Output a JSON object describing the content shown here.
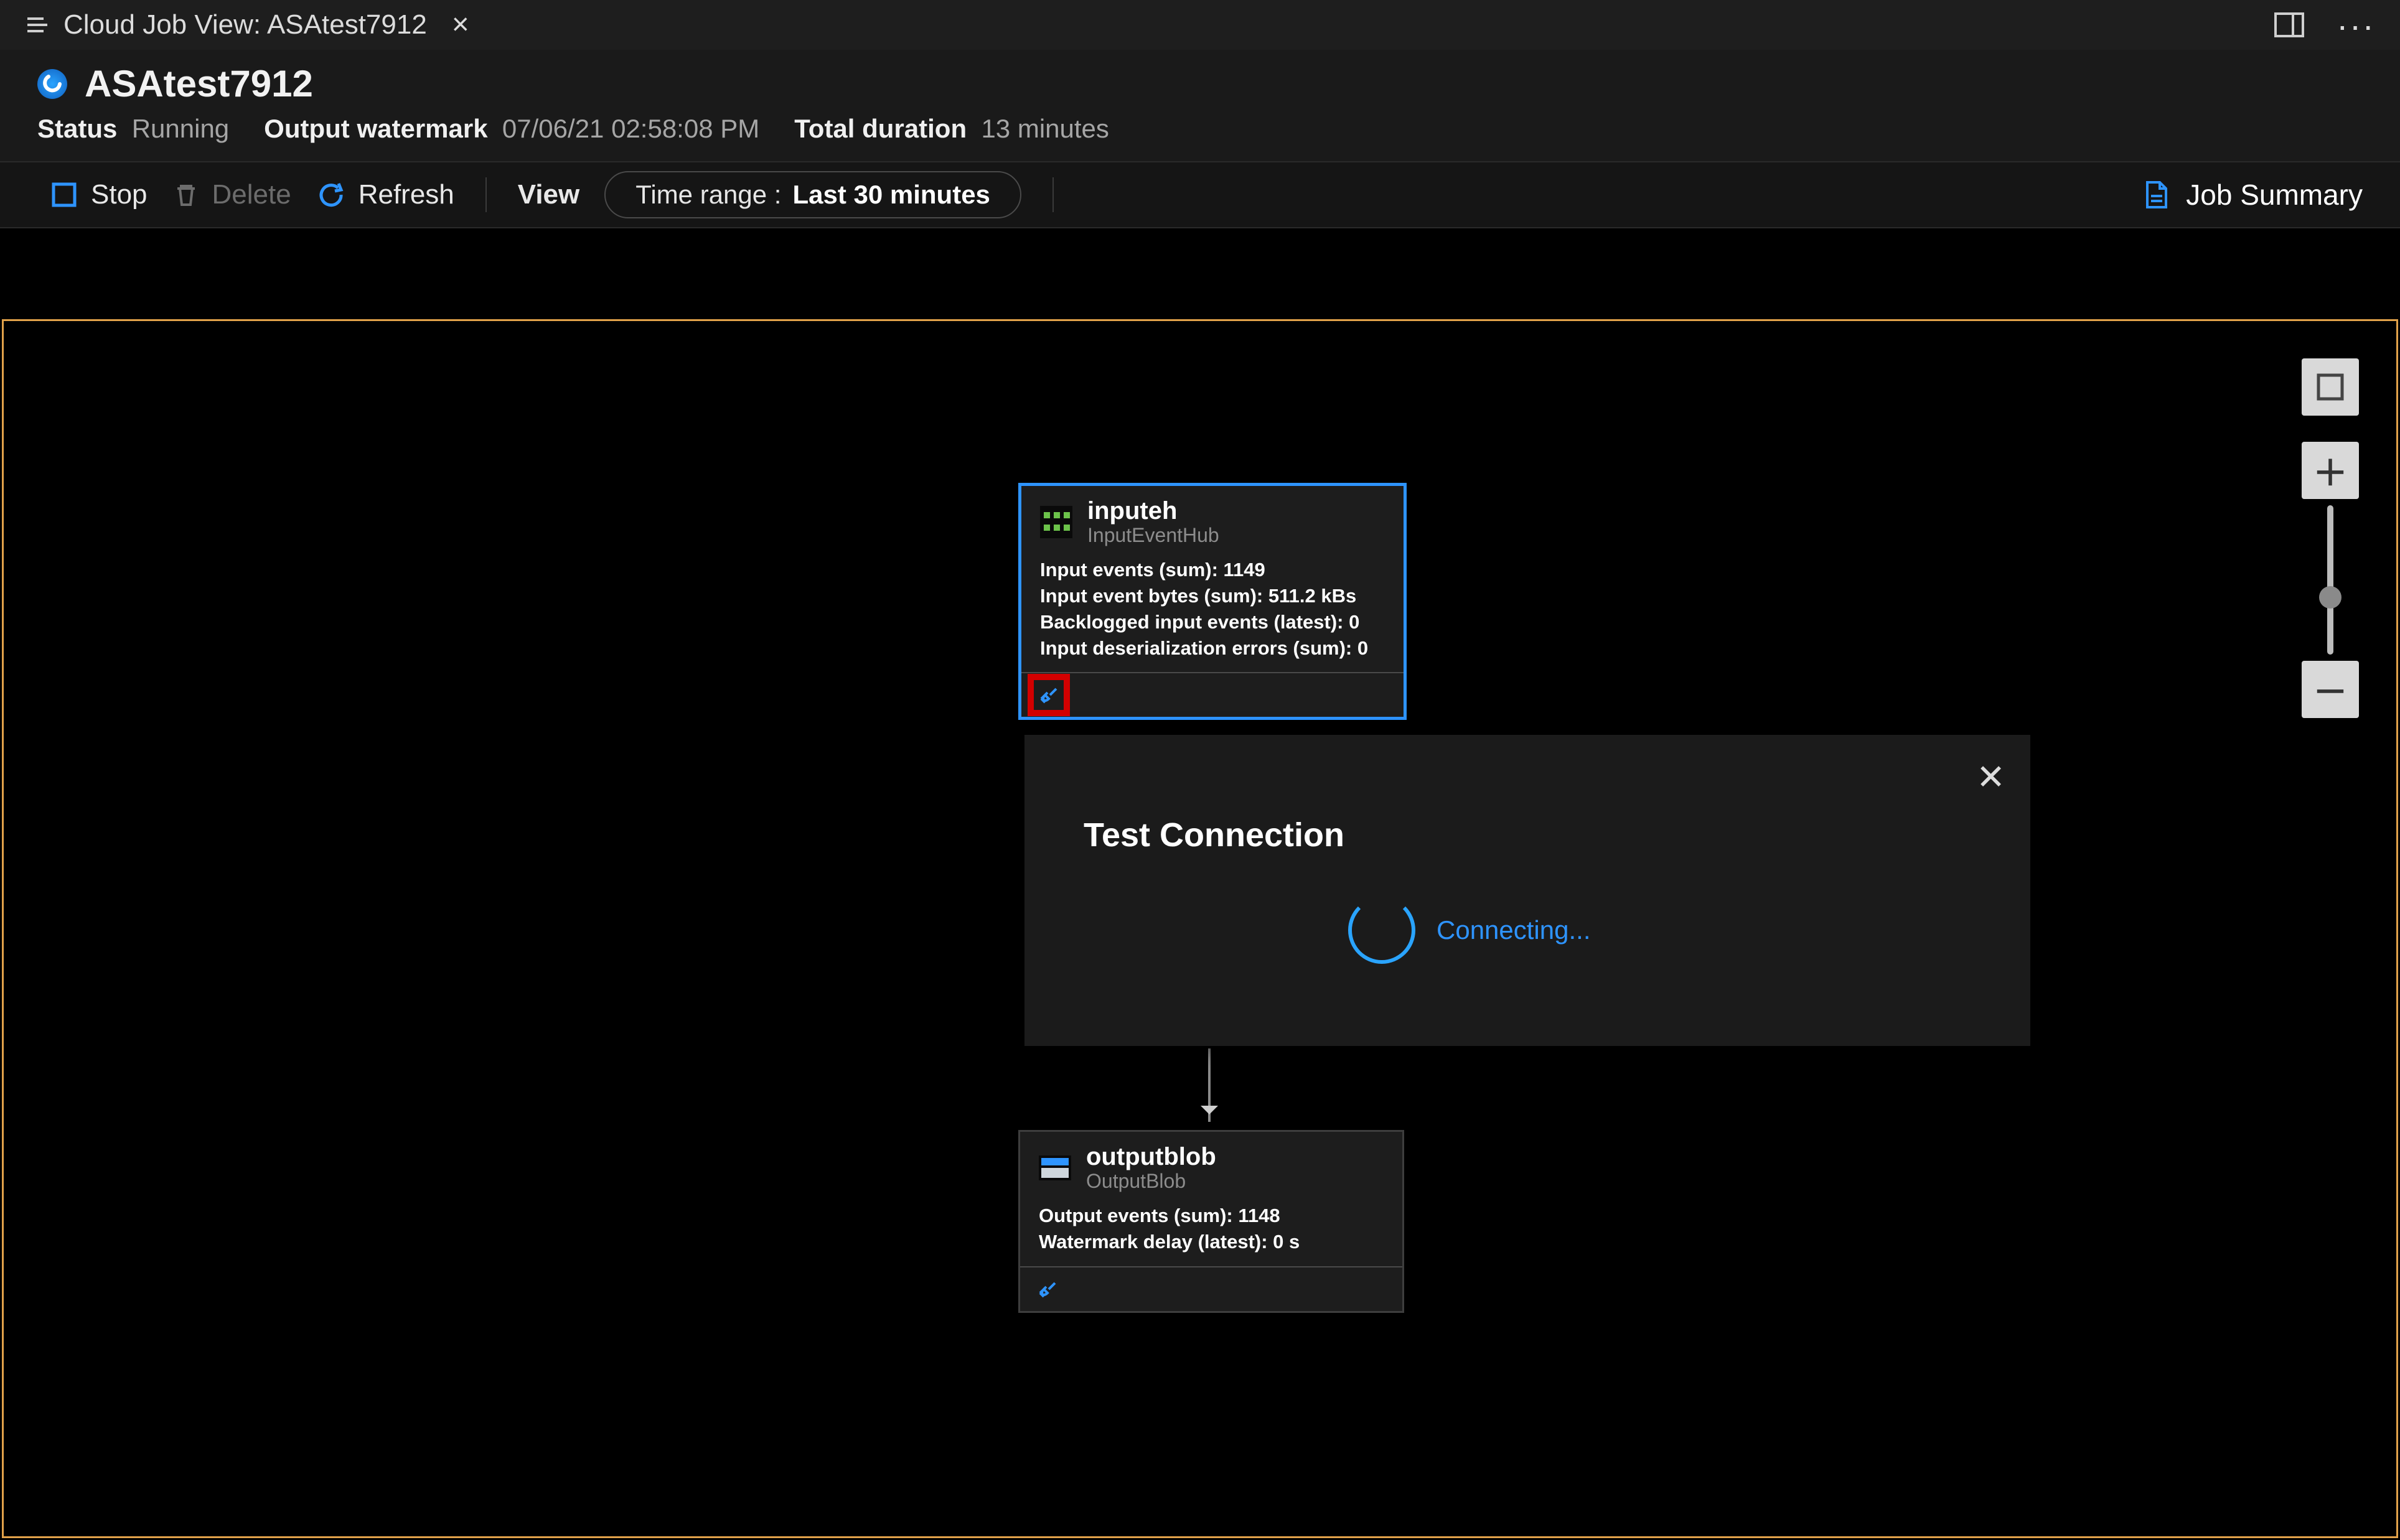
{
  "tab": {
    "title": "Cloud Job View: ASAtest7912"
  },
  "header": {
    "title": "ASAtest7912",
    "status_label": "Status",
    "status_value": "Running",
    "watermark_label": "Output watermark",
    "watermark_value": "07/06/21 02:58:08 PM",
    "duration_label": "Total duration",
    "duration_value": "13 minutes"
  },
  "toolbar": {
    "stop": "Stop",
    "delete": "Delete",
    "refresh": "Refresh",
    "view": "View",
    "time_label": "Time range :",
    "time_value": "Last 30 minutes",
    "summary": "Job Summary"
  },
  "nodes": {
    "input": {
      "name": "inputeh",
      "type": "InputEventHub",
      "metrics": [
        "Input events (sum): 1149",
        "Input event bytes (sum): 511.2 kBs",
        "Backlogged input events (latest): 0",
        "Input deserialization errors (sum): 0"
      ]
    },
    "output": {
      "name": "outputblob",
      "type": "OutputBlob",
      "metrics": [
        "Output events (sum): 1148",
        "Watermark delay (latest): 0 s"
      ]
    }
  },
  "modal": {
    "title": "Test Connection",
    "status": "Connecting..."
  }
}
